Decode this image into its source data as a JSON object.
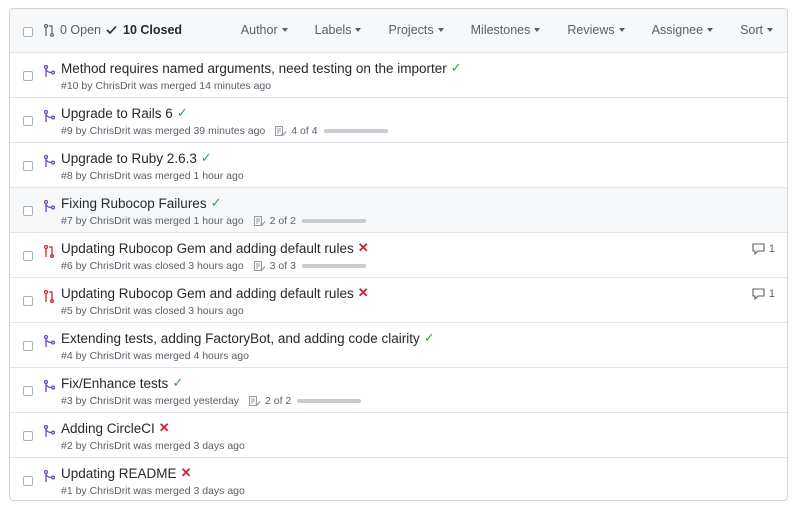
{
  "header": {
    "open_label": "0 Open",
    "closed_label": "10 Closed",
    "filters": [
      "Author",
      "Labels",
      "Projects",
      "Milestones",
      "Reviews",
      "Assignee",
      "Sort"
    ]
  },
  "colors": {
    "merged": "#6f42c1",
    "closed": "#cb2431",
    "success": "#28a745",
    "failure": "#cb2431"
  },
  "pulls": [
    {
      "title": "Method requires named arguments, need testing on the importer",
      "status": "success",
      "state": "merged",
      "meta": "#10 by ChrisDrit was merged 14 minutes ago",
      "tasks": null,
      "tasks_progress": null,
      "comments": null
    },
    {
      "title": "Upgrade to Rails 6",
      "status": "success",
      "state": "merged",
      "meta": "#9 by ChrisDrit was merged 39 minutes ago",
      "tasks": "4 of 4",
      "tasks_progress": 1,
      "comments": null
    },
    {
      "title": "Upgrade to Ruby 2.6.3",
      "status": "success",
      "state": "merged",
      "meta": "#8 by ChrisDrit was merged 1 hour ago",
      "tasks": null,
      "tasks_progress": null,
      "comments": null
    },
    {
      "title": "Fixing Rubocop Failures",
      "status": "success",
      "state": "merged",
      "meta": "#7 by ChrisDrit was merged 1 hour ago",
      "tasks": "2 of 2",
      "tasks_progress": 1,
      "comments": null
    },
    {
      "title": "Updating Rubocop Gem and adding default rules",
      "status": "failure",
      "state": "closed",
      "meta": "#6 by ChrisDrit was closed 3 hours ago",
      "tasks": "3 of 3",
      "tasks_progress": 1,
      "comments": "1"
    },
    {
      "title": "Updating Rubocop Gem and adding default rules",
      "status": "failure",
      "state": "closed",
      "meta": "#5 by ChrisDrit was closed 3 hours ago",
      "tasks": null,
      "tasks_progress": null,
      "comments": "1"
    },
    {
      "title": "Extending tests, adding FactoryBot, and adding code clairity",
      "status": "success",
      "state": "merged",
      "meta": "#4 by ChrisDrit was merged 4 hours ago",
      "tasks": null,
      "tasks_progress": null,
      "comments": null
    },
    {
      "title": "Fix/Enhance tests",
      "status": "success",
      "state": "merged",
      "meta": "#3 by ChrisDrit was merged yesterday",
      "tasks": "2 of 2",
      "tasks_progress": 1,
      "comments": null
    },
    {
      "title": "Adding CircleCI",
      "status": "failure",
      "state": "merged",
      "meta": "#2 by ChrisDrit was merged 3 days ago",
      "tasks": null,
      "tasks_progress": null,
      "comments": null
    },
    {
      "title": "Updating README",
      "status": "failure",
      "state": "merged",
      "meta": "#1 by ChrisDrit was merged 3 days ago",
      "tasks": null,
      "tasks_progress": null,
      "comments": null
    }
  ]
}
